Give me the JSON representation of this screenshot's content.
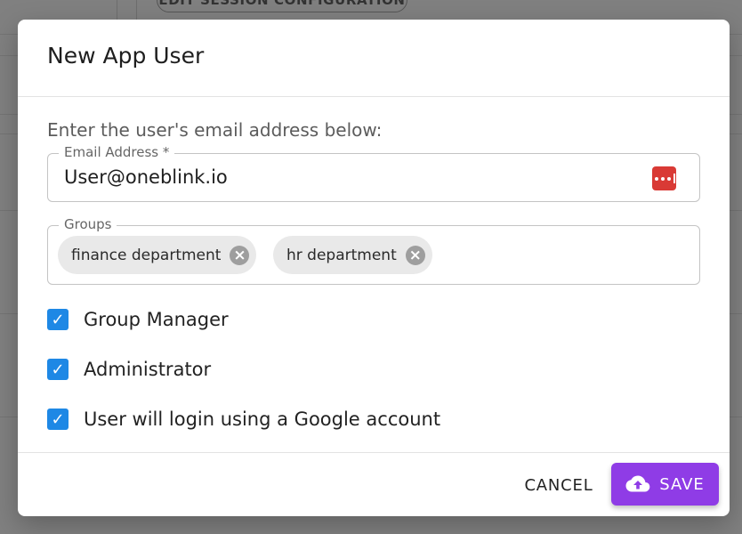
{
  "background": {
    "button_label": "EDIT SESSION CONFIGURATION"
  },
  "dialog": {
    "title": "New App User",
    "intro": "Enter the user's email address below:",
    "email": {
      "label": "Email Address *",
      "value": "User@oneblink.io",
      "icon": "password-manager-icon"
    },
    "groups": {
      "label": "Groups",
      "chips": [
        {
          "label": "finance department",
          "icon": "close-circle-icon"
        },
        {
          "label": "hr department",
          "icon": "close-circle-icon"
        }
      ]
    },
    "checkboxes": [
      {
        "label": "Group Manager",
        "checked": true
      },
      {
        "label": "Administrator",
        "checked": true
      },
      {
        "label": "User will login using a Google account",
        "checked": true
      }
    ],
    "actions": {
      "cancel_label": "CANCEL",
      "save_label": "SAVE",
      "save_icon": "cloud-upload-icon"
    }
  },
  "colors": {
    "accent": "#8f3ce6",
    "checkbox": "#1e88e5",
    "password_icon": "#d93a35"
  }
}
